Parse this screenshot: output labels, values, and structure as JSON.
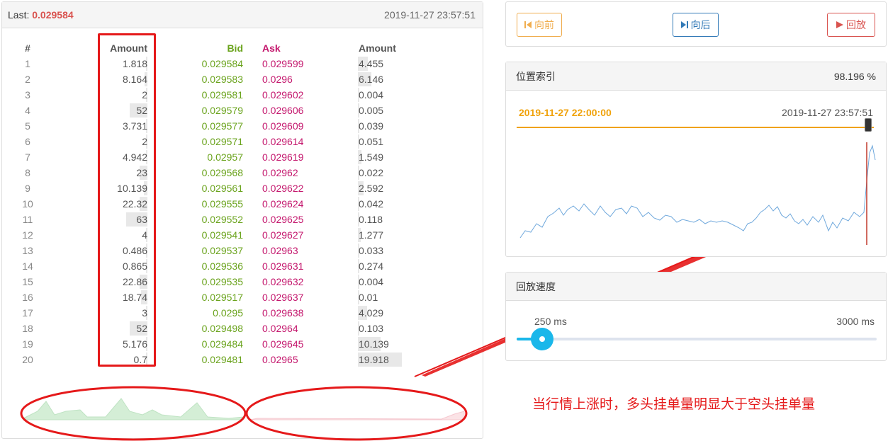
{
  "orderbook": {
    "last_label": "Last:",
    "last_value": "0.029584",
    "timestamp": "2019-11-27 23:57:51",
    "headers": {
      "idx": "#",
      "amount_bid": "Amount",
      "bid": "Bid",
      "ask": "Ask",
      "amount_ask": "Amount"
    },
    "rows": [
      {
        "idx": "1",
        "amount_bid": "1.818",
        "bid": "0.029584",
        "ask": "0.029599",
        "amount_ask": "4.455"
      },
      {
        "idx": "2",
        "amount_bid": "8.164",
        "bid": "0.029583",
        "ask": "0.0296",
        "amount_ask": "6.146"
      },
      {
        "idx": "3",
        "amount_bid": "2",
        "bid": "0.029581",
        "ask": "0.029602",
        "amount_ask": "0.004"
      },
      {
        "idx": "4",
        "amount_bid": "52",
        "bid": "0.029579",
        "ask": "0.029606",
        "amount_ask": "0.005"
      },
      {
        "idx": "5",
        "amount_bid": "3.731",
        "bid": "0.029577",
        "ask": "0.029609",
        "amount_ask": "0.039"
      },
      {
        "idx": "6",
        "amount_bid": "2",
        "bid": "0.029571",
        "ask": "0.029614",
        "amount_ask": "0.051"
      },
      {
        "idx": "7",
        "amount_bid": "4.942",
        "bid": "0.02957",
        "ask": "0.029619",
        "amount_ask": "1.549"
      },
      {
        "idx": "8",
        "amount_bid": "23",
        "bid": "0.029568",
        "ask": "0.02962",
        "amount_ask": "0.022"
      },
      {
        "idx": "9",
        "amount_bid": "10.139",
        "bid": "0.029561",
        "ask": "0.029622",
        "amount_ask": "2.592"
      },
      {
        "idx": "10",
        "amount_bid": "22.32",
        "bid": "0.029555",
        "ask": "0.029624",
        "amount_ask": "0.042"
      },
      {
        "idx": "11",
        "amount_bid": "63",
        "bid": "0.029552",
        "ask": "0.029625",
        "amount_ask": "0.118"
      },
      {
        "idx": "12",
        "amount_bid": "4",
        "bid": "0.029541",
        "ask": "0.029627",
        "amount_ask": "1.277"
      },
      {
        "idx": "13",
        "amount_bid": "0.486",
        "bid": "0.029537",
        "ask": "0.02963",
        "amount_ask": "0.033"
      },
      {
        "idx": "14",
        "amount_bid": "0.865",
        "bid": "0.029536",
        "ask": "0.029631",
        "amount_ask": "0.274"
      },
      {
        "idx": "15",
        "amount_bid": "22.86",
        "bid": "0.029535",
        "ask": "0.029632",
        "amount_ask": "0.004"
      },
      {
        "idx": "16",
        "amount_bid": "18.74",
        "bid": "0.029517",
        "ask": "0.029637",
        "amount_ask": "0.01"
      },
      {
        "idx": "17",
        "amount_bid": "3",
        "bid": "0.0295",
        "ask": "0.029638",
        "amount_ask": "4.029"
      },
      {
        "idx": "18",
        "amount_bid": "52",
        "bid": "0.029498",
        "ask": "0.02964",
        "amount_ask": "0.103"
      },
      {
        "idx": "19",
        "amount_bid": "5.176",
        "bid": "0.029484",
        "ask": "0.029645",
        "amount_ask": "10.139"
      },
      {
        "idx": "20",
        "amount_bid": "0.7",
        "bid": "0.029481",
        "ask": "0.02965",
        "amount_ask": "19.918"
      }
    ]
  },
  "controls": {
    "prev_label": "向前",
    "next_label": "向后",
    "replay_label": "回放",
    "prev_color": "#f0ad4e",
    "next_color": "#337ab7",
    "replay_color": "#d9534f"
  },
  "position": {
    "title": "位置索引",
    "percent": "98.196 %",
    "start_time": "2019-11-27 22:00:00",
    "end_time": "2019-11-27 23:57:51",
    "progress_fraction": 0.982
  },
  "speed": {
    "title": "回放速度",
    "current": "250 ms",
    "max": "3000 ms",
    "level_fraction": 0.07
  },
  "annotation": {
    "text": "当行情上涨时，多头挂单量明显大于空头挂单量"
  },
  "colors": {
    "bid_green": "#6aa31c",
    "ask_pink": "#c4176d",
    "annotation_red": "#e5191a",
    "orange": "#f0a20a",
    "slider_blue": "#1ab7ea"
  }
}
